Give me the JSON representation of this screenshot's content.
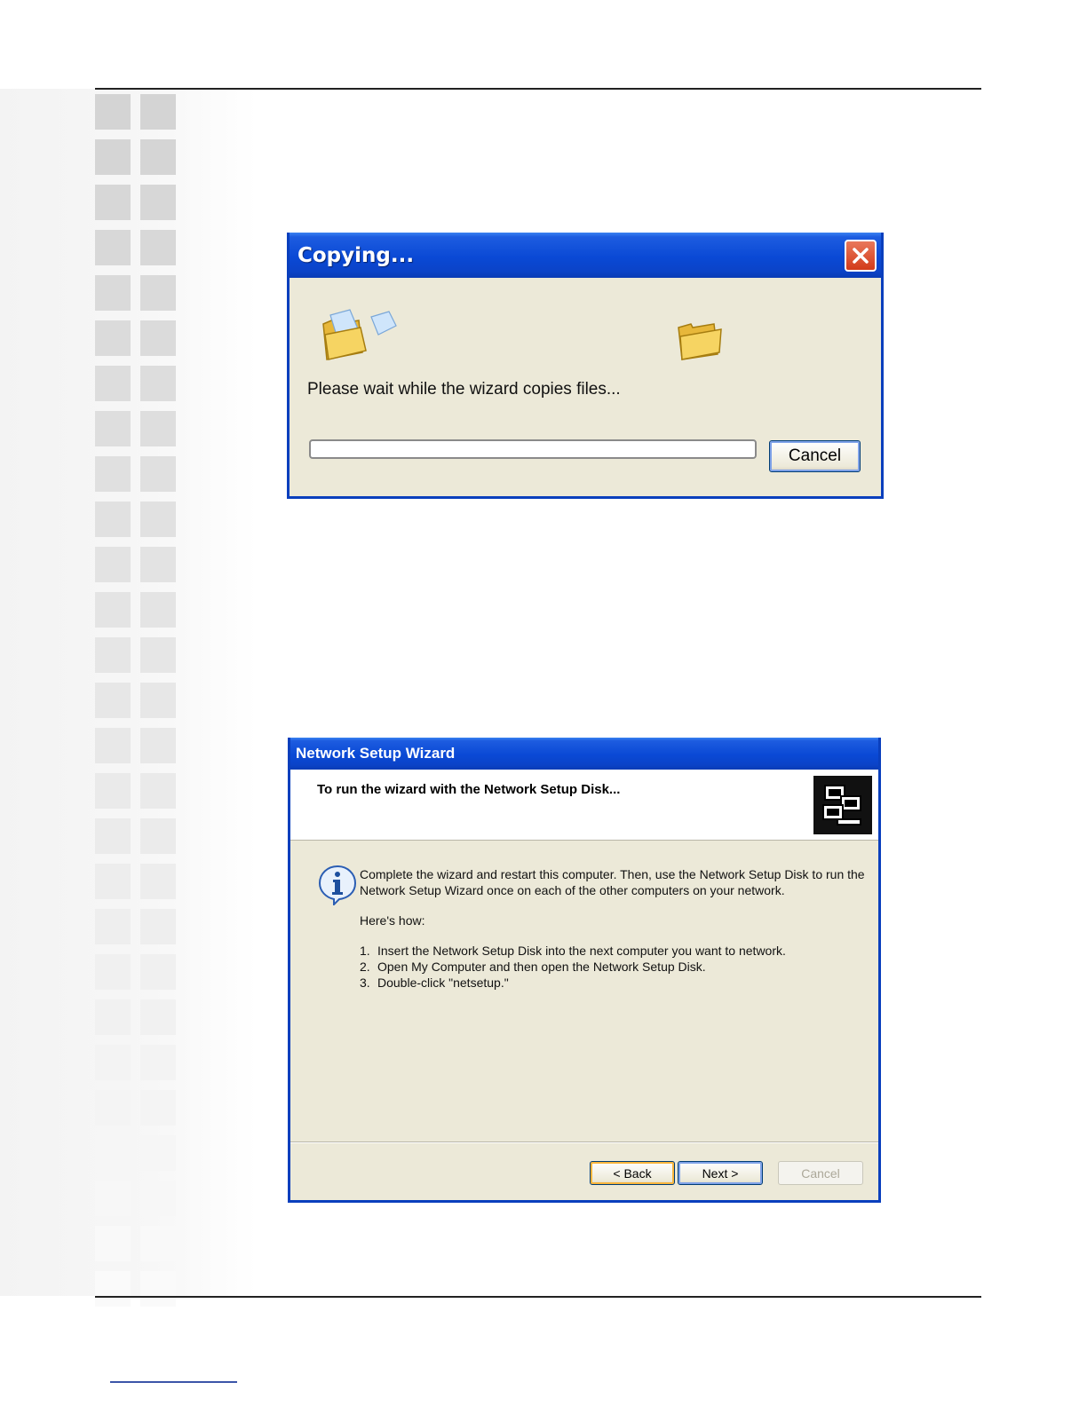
{
  "copy_dialog": {
    "title": "Copying...",
    "message": "Please wait while the wizard copies files...",
    "progress": 0,
    "cancel_label": "Cancel",
    "icons": [
      "folder-open-icon",
      "flying-file-icon",
      "folder-destination-icon",
      "close-icon"
    ]
  },
  "wizard": {
    "title": "Network Setup Wizard",
    "heading": "To run the wizard with the Network Setup Disk...",
    "intro": "Complete the wizard and restart this computer. Then, use the Network Setup Disk to run the Network Setup Wizard once on each of the other computers on your network.",
    "howto": "Here's how:",
    "steps": [
      {
        "num": "1.",
        "text": "Insert the Network Setup Disk into the next computer you want to network."
      },
      {
        "num": "2.",
        "text": "Open My Computer and then open the Network Setup Disk."
      },
      {
        "num": "3.",
        "text": "Double-click \"netsetup.\""
      }
    ],
    "buttons": {
      "back": "< Back",
      "next": "Next >",
      "cancel": "Cancel"
    },
    "icons": [
      "info-icon",
      "network-computers-icon"
    ]
  },
  "colors": {
    "title_bar": "#0a49d5",
    "dialog_bg": "#ece9d8",
    "close_red": "#d23a1a"
  }
}
